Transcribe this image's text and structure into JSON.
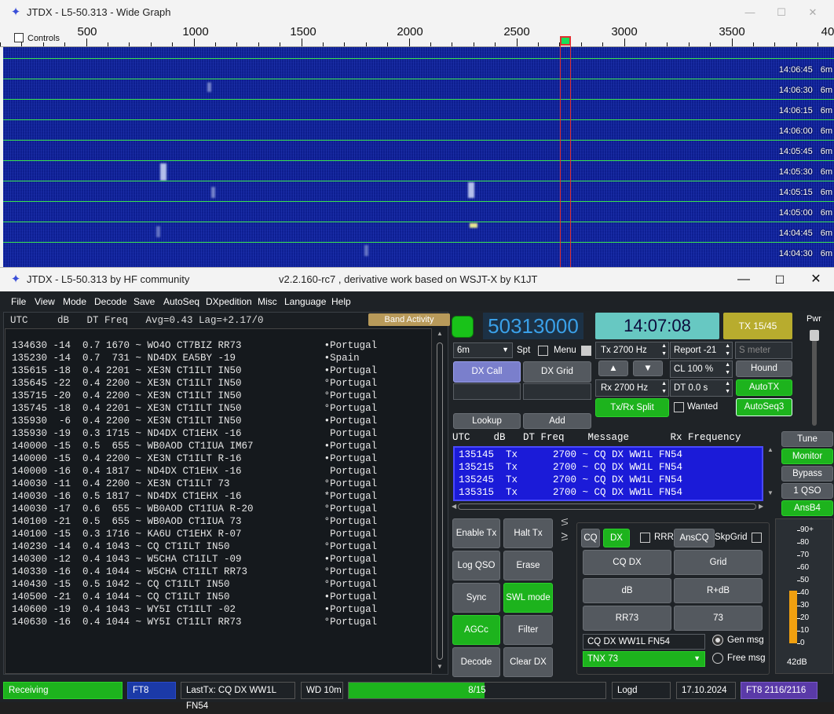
{
  "wide_graph": {
    "title": "JTDX - L5-50.313 - Wide Graph",
    "controls_label": "Controls",
    "freq_labels": [
      "500",
      "1000",
      "1500",
      "2000",
      "2500",
      "3000",
      "3500",
      "40"
    ],
    "timestamps": [
      {
        "time": "14:06:45",
        "band": "6m"
      },
      {
        "time": "14:06:30",
        "band": "6m"
      },
      {
        "time": "14:06:15",
        "band": "6m"
      },
      {
        "time": "14:06:00",
        "band": "6m"
      },
      {
        "time": "14:05:45",
        "band": "6m"
      },
      {
        "time": "14:05:30",
        "band": "6m"
      },
      {
        "time": "14:05:15",
        "band": "6m"
      },
      {
        "time": "14:05:00",
        "band": "6m"
      },
      {
        "time": "14:04:45",
        "band": "6m"
      },
      {
        "time": "14:04:30",
        "band": "6m"
      }
    ]
  },
  "main": {
    "title": "JTDX - L5-50.313  by HF community",
    "subtitle": "v2.2.160-rc7 , derivative work based on WSJT-X by K1JT",
    "menu": [
      "File",
      "View",
      "Mode",
      "Decode",
      "Save",
      "AutoSeq",
      "DXpedition",
      "Misc",
      "Language",
      "Help"
    ]
  },
  "band_activity": {
    "header": "UTC     dB   DT Freq   Avg=0.43 Lag=+2.17/0",
    "button": "Band Activity",
    "rows": [
      "134630 -14  0.7 1670 ~ WO4O CT7BIZ RR73              •Portugal",
      "135230 -14  0.7  731 ~ ND4DX EA5BY -19               •Spain",
      "135615 -18  0.4 2201 ~ XE3N CT1ILT IN50              •Portugal",
      "135645 -22  0.4 2200 ~ XE3N CT1ILT IN50              °Portugal",
      "135715 -20  0.4 2200 ~ XE3N CT1ILT IN50              °Portugal",
      "135745 -18  0.4 2201 ~ XE3N CT1ILT IN50              °Portugal",
      "135930  -6  0.4 2200 ~ XE3N CT1ILT IN50              •Portugal",
      "135930 -19  0.3 1715 ~ ND4DX CT1EHX -16               Portugal",
      "140000 -15  0.5  655 ~ WB0AOD CT1IUA IM67            •Portugal",
      "140000 -15  0.4 2200 ~ XE3N CT1ILT R-16              •Portugal",
      "140000 -16  0.4 1817 ~ ND4DX CT1EHX -16               Portugal",
      "140030 -11  0.4 2200 ~ XE3N CT1ILT 73                °Portugal",
      "140030 -16  0.5 1817 ~ ND4DX CT1EHX -16              *Portugal",
      "140030 -17  0.6  655 ~ WB0AOD CT1IUA R-20            °Portugal",
      "140100 -21  0.5  655 ~ WB0AOD CT1IUA 73              °Portugal",
      "140100 -15  0.3 1716 ~ KA6U CT1EHX R-07               Portugal",
      "140230 -14  0.4 1043 ~ CQ CT1ILT IN50                °Portugal",
      "140300 -12  0.4 1043 ~ W5CHA CT1ILT -09              •Portugal",
      "140330 -16  0.4 1044 ~ W5CHA CT1ILT RR73             °Portugal",
      "140430 -15  0.5 1042 ~ CQ CT1ILT IN50                °Portugal",
      "140500 -21  0.4 1044 ~ CQ CT1ILT IN50                •Portugal",
      "140600 -19  0.4 1043 ~ WY5I CT1ILT -02               •Portugal",
      "140630 -16  0.4 1044 ~ WY5I CT1ILT RR73              °Portugal"
    ]
  },
  "top": {
    "frequency": "50313000",
    "clock": "14:07:08",
    "tx_period": "TX 15/45",
    "pwr_label": "Pwr",
    "band": "6m",
    "spt": "Spt",
    "menu_label": "Menu",
    "tx_hz": "Tx  2700 Hz",
    "rx_hz": "Rx  2700 Hz",
    "report": "Report -21",
    "smeter_field": "S meter",
    "cl": "CL  100 %",
    "dt": "DT 0.0 s",
    "hound": "Hound",
    "autotx": "AutoTX",
    "autoseq3": "AutoSeq3",
    "wanted": "Wanted",
    "split": "Tx/Rx Split",
    "dx_call": "DX Call",
    "dx_grid": "DX Grid",
    "lookup": "Lookup",
    "add": "Add",
    "up": "▲",
    "down": "▼"
  },
  "tx_table": {
    "header": "UTC    dB   DT Freq    Message       Rx Frequency",
    "rows": [
      "135145  Tx      2700 ~ CQ DX WW1L FN54",
      "135215  Tx      2700 ~ CQ DX WW1L FN54",
      "135245  Tx      2700 ~ CQ DX WW1L FN54",
      "135315  Tx      2700 ~ CQ DX WW1L FN54"
    ]
  },
  "side_buttons": [
    "Tune",
    "Monitor",
    "Bypass",
    "1 QSO",
    "AnsB4"
  ],
  "left_buttons": [
    "Enable Tx",
    "Halt Tx",
    "Log QSO",
    "Erase",
    "Sync",
    "SWL mode",
    "AGCc",
    "Filter",
    "Decode",
    "Clear DX"
  ],
  "tabs": [
    "\\/\\",
    "Λ\\"
  ],
  "msg_panel": {
    "cq": "CQ",
    "dx": "DX",
    "rrr": "RRR",
    "anscq": "AnsCQ",
    "skpgrid": "SkpGrid",
    "buttons": [
      "CQ DX",
      "Grid",
      "dB",
      "R+dB",
      "RR73",
      "73"
    ],
    "gen_text": "CQ DX WW1L FN54",
    "free_text": "TNX 73",
    "gen_msg": "Gen msg",
    "free_msg": "Free msg"
  },
  "smeter": {
    "ticks": [
      "90+",
      "80",
      "70",
      "60",
      "50",
      "40",
      "30",
      "20",
      "10",
      "0"
    ],
    "reading": "42dB",
    "level_db": 42
  },
  "status": {
    "receiving": "Receiving",
    "mode": "FT8",
    "last_tx": "LastTx: CQ DX WW1L FN54",
    "wd": "WD 10m",
    "progress": "8/15",
    "progress_fraction": 0.53,
    "logd": "Logd",
    "date": "17.10.2024",
    "ft8_count": "FT8  2116/2116"
  },
  "colors": {
    "green": "#1db31d",
    "blue_list": "#1b1bd8",
    "clock": "#67c8c2",
    "tx_period": "#b8ac2e",
    "waterfall": "#0b1c8a"
  }
}
